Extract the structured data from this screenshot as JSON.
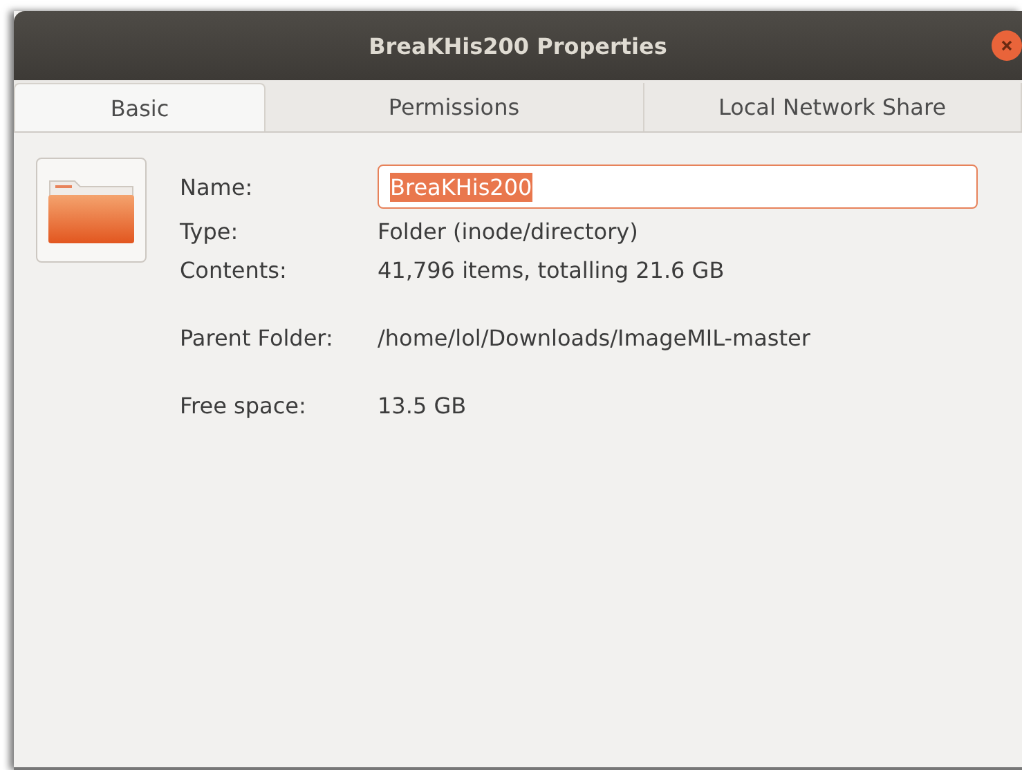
{
  "window": {
    "title": "BreaKHis200 Properties"
  },
  "tabs": [
    {
      "label": "Basic",
      "selected": true
    },
    {
      "label": "Permissions",
      "selected": false
    },
    {
      "label": "Local Network Share",
      "selected": false
    }
  ],
  "groups": [
    {
      "rows": [
        {
          "kind": "field",
          "label": "Name:",
          "value": "BreaKHis200",
          "text_selected": true
        },
        {
          "kind": "text",
          "label": "Type:",
          "value": "Folder (inode/directory)"
        },
        {
          "kind": "text",
          "label": "Contents:",
          "value": "41,796 items, totalling 21.6 GB"
        }
      ]
    },
    {
      "rows": [
        {
          "kind": "text",
          "label": "Parent Folder:",
          "value": "/home/lol/Downloads/ImageMIL-master"
        }
      ]
    },
    {
      "rows": [
        {
          "kind": "text",
          "label": "Free space:",
          "value": "13.5 GB"
        }
      ]
    }
  ]
}
